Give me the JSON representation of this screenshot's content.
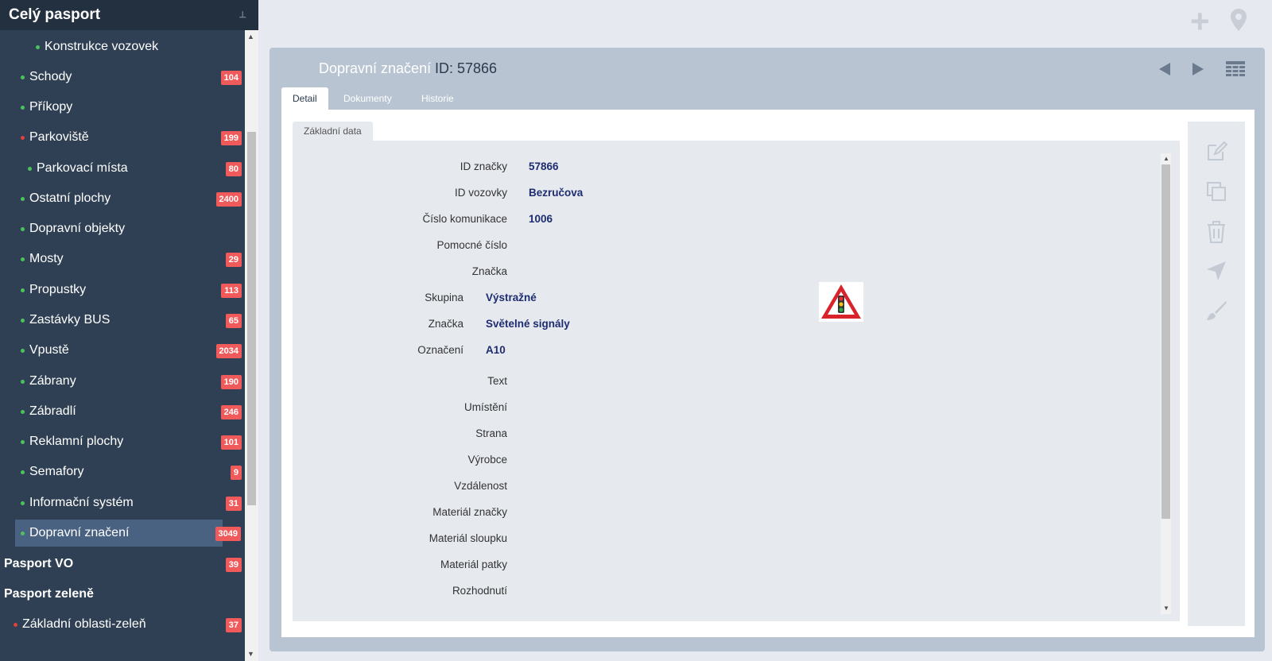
{
  "sidebar": {
    "title": "Celý pasport",
    "items": [
      {
        "label": "Konstrukce vozovek",
        "badge": "",
        "dot": "#4cc25a"
      },
      {
        "label": "Schody",
        "badge": "104",
        "dot": "#4cc25a"
      },
      {
        "label": "Příkopy",
        "badge": "",
        "dot": "#4cc25a"
      },
      {
        "label": "Parkoviště",
        "badge": "199",
        "dot": "#e04040"
      },
      {
        "label": "Parkovací místa",
        "badge": "80",
        "dot": "#4cc25a"
      },
      {
        "label": "Ostatní plochy",
        "badge": "2400",
        "dot": "#4cc25a"
      },
      {
        "label": "Dopravní objekty",
        "badge": "",
        "dot": "#4cc25a"
      },
      {
        "label": "Mosty",
        "badge": "29",
        "dot": "#4cc25a"
      },
      {
        "label": "Propustky",
        "badge": "113",
        "dot": "#4cc25a"
      },
      {
        "label": "Zastávky BUS",
        "badge": "65",
        "dot": "#4cc25a"
      },
      {
        "label": "Vpustě",
        "badge": "2034",
        "dot": "#4cc25a"
      },
      {
        "label": "Zábrany",
        "badge": "190",
        "dot": "#4cc25a"
      },
      {
        "label": "Zábradlí",
        "badge": "246",
        "dot": "#4cc25a"
      },
      {
        "label": "Reklamní plochy",
        "badge": "101",
        "dot": "#4cc25a"
      },
      {
        "label": "Semafory",
        "badge": "9",
        "dot": "#4cc25a"
      },
      {
        "label": "Informační systém",
        "badge": "31",
        "dot": "#4cc25a"
      },
      {
        "label": "Dopravní značení",
        "badge": "3049",
        "dot": "#4cc25a"
      },
      {
        "label": "Pasport VO",
        "badge": "39",
        "dot": ""
      },
      {
        "label": "Pasport zeleně",
        "badge": "",
        "dot": ""
      },
      {
        "label": "Základní oblasti-zeleň",
        "badge": "37",
        "dot": "#e04040"
      }
    ]
  },
  "panel": {
    "title": "Dopravní značení",
    "id_text": "ID: 57866",
    "tabs": [
      "Detail",
      "Dokumenty",
      "Historie"
    ],
    "subtab": "Základní data"
  },
  "fields": [
    {
      "label": "ID značky",
      "value": "57866"
    },
    {
      "label": "ID vozovky",
      "value": "Bezručova"
    },
    {
      "label": "Číslo komunikace",
      "value": "1006"
    },
    {
      "label": "Pomocné číslo",
      "value": ""
    },
    {
      "label": "Značka",
      "value": ""
    },
    {
      "label": "Skupina",
      "value": "Výstražné"
    },
    {
      "label": "Značka",
      "value": "Světelné signály"
    },
    {
      "label": "Označení",
      "value": "A10"
    },
    {
      "label": "Text",
      "value": ""
    },
    {
      "label": "Umístění",
      "value": ""
    },
    {
      "label": "Strana",
      "value": ""
    },
    {
      "label": "Výrobce",
      "value": ""
    },
    {
      "label": "Vzdálenost",
      "value": ""
    },
    {
      "label": "Materiál značky",
      "value": ""
    },
    {
      "label": "Materiál sloupku",
      "value": ""
    },
    {
      "label": "Materiál patky",
      "value": ""
    },
    {
      "label": "Rozhodnutí",
      "value": ""
    }
  ],
  "icons": {
    "add": "plus-icon",
    "map": "map-pin-icon",
    "prev": "arrow-left-icon",
    "next": "arrow-right-icon",
    "grid": "grid-icon",
    "edit": "edit-icon",
    "copy": "copy-icon",
    "delete": "trash-icon",
    "navigate": "navigate-icon",
    "paint": "brush-icon",
    "sign": "traffic-light-warning-sign"
  },
  "colors": {
    "sidebar_bg": "#2f4054",
    "badge": "#f05a5a",
    "active_item": "#4a6281",
    "value_text": "#1e2c70"
  }
}
